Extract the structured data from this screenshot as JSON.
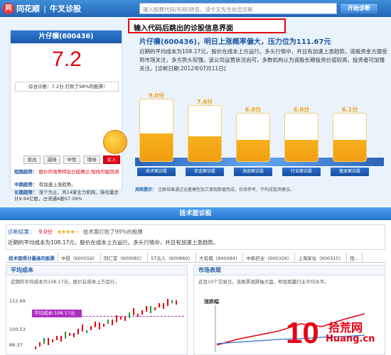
{
  "header": {
    "brand_a": "同花顺",
    "brand_b": "牛叉诊股",
    "search_placeholder": "输入股票代码/名称/拼音，请卡叉先生给您诊断",
    "search_button": "开始诊断"
  },
  "callout": "输入代码后跳出的诊股信息界面",
  "score_card": {
    "title": "片仔癀(600436)",
    "score": "7.2",
    "note": "综合诊断：7.2分 打败了98%的股票!",
    "rating_buttons": [
      "卖出",
      "减持",
      "中性",
      "增持",
      "买入"
    ],
    "rating_selected": 4,
    "trend_short_label": "短期趋势：",
    "trend_short_text": "股价的涨势特征已经确立,短线可能回调",
    "trend_mid_label": "中期趋势：",
    "trend_mid_text": "有加速上涨趋势。",
    "trend_long_label": "长期趋势：",
    "trend_long_text": "涨个为止，共14家主力机构，持仓量总计9.94亿股，占流通A股67.09%"
  },
  "headline": "片仔癀(600436)，明日上涨概率偏大，压力位为111.67元",
  "description": "近期的平均成本为108.17元，股价在成本上方运行。多头行情中，并且有加速上涨趋势。该股资金方面受到市场关注，多方势头较强。该公司运营状况尚可，多数机构认为该股长期投资价值较高，投资者可加强关注。[诊断日期:2012年07月11日]",
  "bars": {
    "scores": [
      "9.0分",
      "7.6分",
      "6.0分",
      "6.0分",
      "6.1分"
    ],
    "values": [
      9.0,
      7.6,
      6.0,
      6.0,
      6.1
    ],
    "labels": [
      "技术面诊股",
      "资金面诊股",
      "消息面诊股",
      "行业面诊股",
      "基本面诊股"
    ]
  },
  "risk": {
    "label": "风险提示：",
    "text": "注解结果通过运量模型加工客观数据而成，仅供参考，不构成投资建议。"
  },
  "section_title": "技术面诊股",
  "tech_box": {
    "result_label": "诊断结果：",
    "result_score": "9.0分",
    "stars": "★★★★☆",
    "result_tail": "技术面打败了99%的股票",
    "summary": "近期的平均成本为108.17元，股价在成本上方运行。多头行情中，并且有加速上涨趋势。"
  },
  "tabs": [
    "技术面得分最高的股票",
    "中投（600559）",
    "同仁堂（600085）",
    "ST北人（600860）",
    "大名城（600094）",
    "中新药业（600329）",
    "上海家化（600315）",
    "恒..."
  ],
  "left_panel": {
    "title": "平均成本",
    "note": "近期的平均成本为108.17元，股价在成本上方运行。",
    "y_ticks": [
      "112.69",
      "100.53",
      "88.37"
    ],
    "cost_label": "平均成本:108.17元"
  },
  "right_panel": {
    "title": "市场表现",
    "note": "近且10个交易日，该股票涨跌幅大盘，明显跑赢行业平均水平。",
    "chart_label": "涨跌幅"
  },
  "watermark": {
    "ten": "10",
    "cn": "拾荒网",
    "url": "Huang.cn"
  }
}
